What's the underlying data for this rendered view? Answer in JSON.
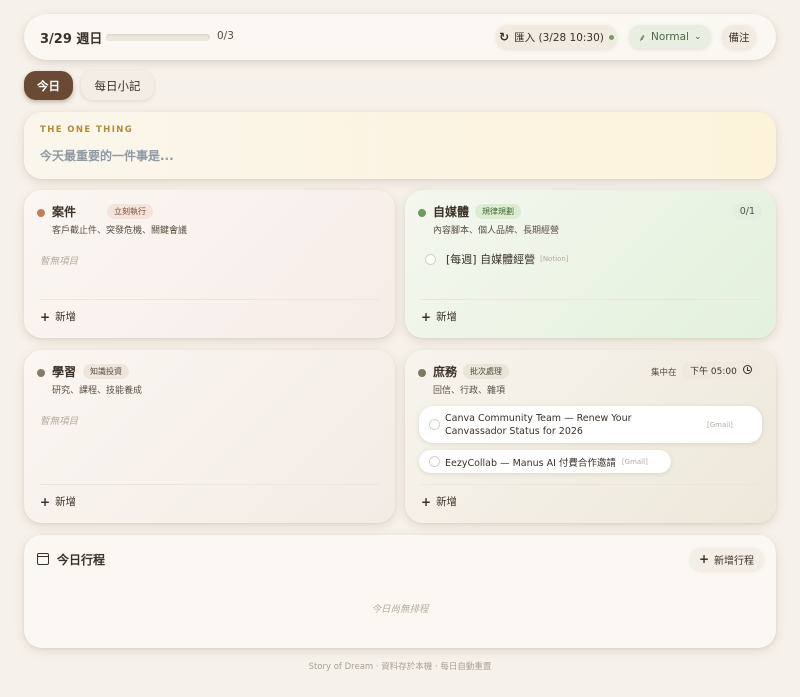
{
  "header": {
    "week_title": "3/29 週日",
    "progress_count": "0/3",
    "progress_fraction": 0,
    "import_label": "匯入 (3/28 10:30)",
    "mode_label": "Normal",
    "note_label": "備注"
  },
  "tabs": [
    {
      "label": "今日",
      "active": true
    },
    {
      "label": "每日小記",
      "active": false
    }
  ],
  "one_thing": {
    "label": "THE ONE THING",
    "placeholder": "今天最重要的一件事是..."
  },
  "quadrants": {
    "cases": {
      "title": "案件",
      "badge": "立刻執行",
      "subtitle": "客戶截止件、突發危機、關鍵會議",
      "empty_text": "暫無項目",
      "add_label": "新增",
      "dot_color": "#c0805a"
    },
    "media": {
      "title": "自媒體",
      "badge": "規律規劃",
      "subtitle": "內容腳本、個人品牌、長期經營",
      "count": "0/1",
      "tasks": [
        {
          "text": "[每週] 自媒體經營",
          "source": "[Notion]"
        }
      ],
      "add_label": "新增",
      "dot_color": "#6f9a58"
    },
    "learning": {
      "title": "學習",
      "badge": "知識投資",
      "subtitle": "研究、課程、技能養成",
      "empty_text": "暫無項目",
      "add_label": "新增",
      "dot_color": "#8a7a6a"
    },
    "admin": {
      "title": "庶務",
      "badge": "批次處理",
      "subtitle": "回信、行政、雜項",
      "focus_label": "集中在",
      "focus_time": "下午 05:00",
      "tasks": [
        {
          "text": "Canva Community Team — Renew Your Canvassador Status for 2026",
          "source": "[Gmail]"
        },
        {
          "text": "EezyCollab — Manus AI 付費合作邀請",
          "source": "[Gmail]"
        }
      ],
      "add_label": "新增",
      "dot_color": "#7d7a62"
    }
  },
  "schedule": {
    "title": "今日行程",
    "add_label": "新增行程",
    "empty_text": "今日尚無排程"
  },
  "footer": "Story of Dream · 資料存於本機 · 每日自動重置"
}
